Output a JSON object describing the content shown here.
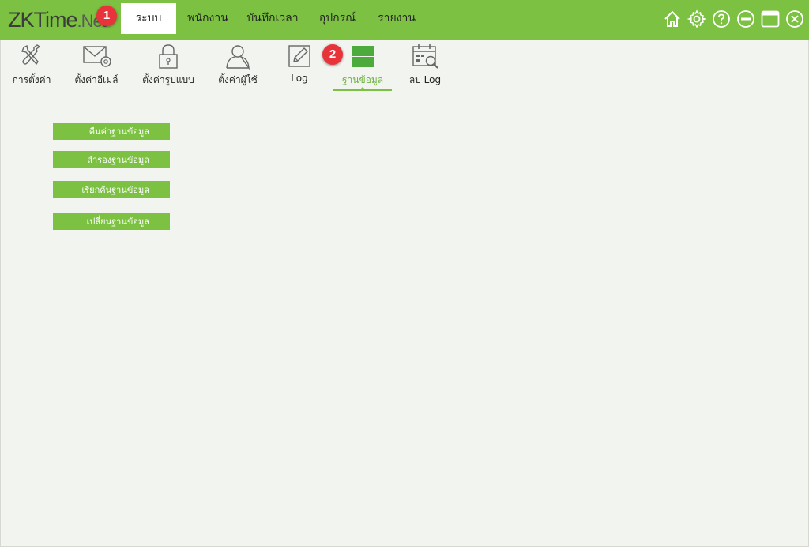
{
  "app": {
    "logo_main": "ZKTime",
    "logo_suffix": ".Net"
  },
  "menu": [
    {
      "label": "ระบบ",
      "active": true
    },
    {
      "label": "พนักงาน",
      "active": false
    },
    {
      "label": "บันทึกเวลา",
      "active": false
    },
    {
      "label": "อุปกรณ์",
      "active": false
    },
    {
      "label": "รายงาน",
      "active": false
    }
  ],
  "window_controls": [
    "home-icon",
    "gear-icon",
    "help-icon",
    "minimize-icon",
    "maximize-icon",
    "close-icon"
  ],
  "toolbar": [
    {
      "label": "การตั้งค่า",
      "icon": "tools-icon"
    },
    {
      "label": "ตั้งค่าอีเมล์",
      "icon": "email-settings-icon"
    },
    {
      "label": "ตั้งค่ารูปแบบ",
      "icon": "lock-icon"
    },
    {
      "label": "ตั้งค่าผู้ใช้",
      "icon": "user-icon"
    },
    {
      "label": "Log",
      "icon": "edit-log-icon"
    },
    {
      "label": "ฐานข้อมูล",
      "icon": "database-icon",
      "active": true
    },
    {
      "label": "ลบ Log",
      "icon": "calendar-search-icon"
    }
  ],
  "badges": {
    "first": "1",
    "second": "2"
  },
  "database_actions": [
    "คืนค่าฐานข้อมูล",
    "สำรองฐานข้อมูล",
    "เรียกคืนฐานข้อมูล",
    "เปลี่ยนฐานข้อมูล"
  ],
  "colors": {
    "brand_green": "#7cc142",
    "badge_red": "#e8333a",
    "background": "#f2f4ef"
  }
}
